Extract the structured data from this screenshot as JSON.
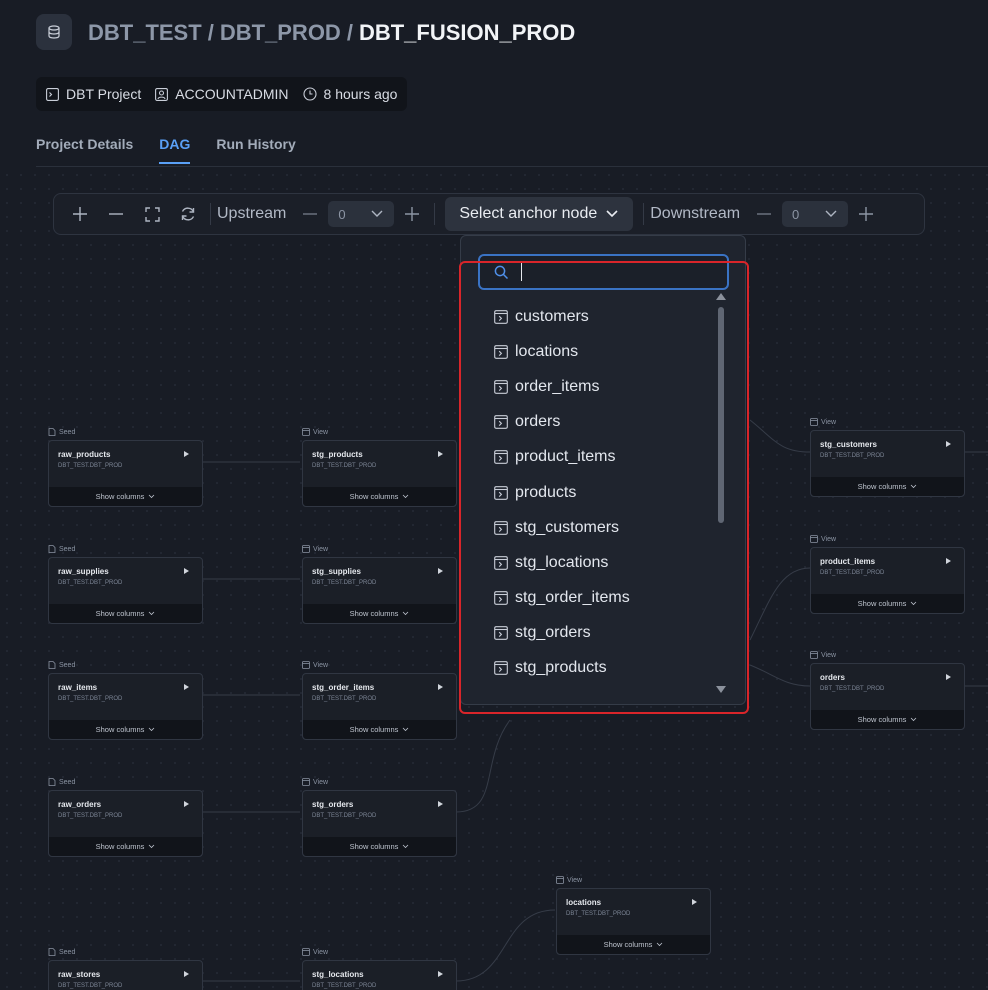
{
  "header": {
    "breadcrumb": [
      "DBT_TEST",
      "DBT_PROD",
      "DBT_FUSION_PROD"
    ],
    "meta": {
      "project": "DBT Project",
      "owner": "ACCOUNTADMIN",
      "modified": "8 hours ago"
    }
  },
  "tabs": [
    {
      "label": "Project Details",
      "active": false
    },
    {
      "label": "DAG",
      "active": true
    },
    {
      "label": "Run History",
      "active": false
    }
  ],
  "toolbar": {
    "upstream_label": "Upstream",
    "upstream_value": "0",
    "anchor_label": "Select anchor node",
    "downstream_label": "Downstream",
    "downstream_value": "0"
  },
  "dropdown": {
    "search_value": "",
    "options": [
      "customers",
      "locations",
      "order_items",
      "orders",
      "product_items",
      "products",
      "stg_customers",
      "stg_locations",
      "stg_order_items",
      "stg_orders",
      "stg_products"
    ]
  },
  "dag": {
    "show_columns_label": "Show columns",
    "nodes": [
      {
        "type": "Seed",
        "name": "raw_products",
        "schema": "DBT_TEST.DBT_PROD"
      },
      {
        "type": "View",
        "name": "stg_products",
        "schema": "DBT_TEST.DBT_PROD"
      },
      {
        "type": "View",
        "name": "stg_customers",
        "schema": "DBT_TEST.DBT_PROD"
      },
      {
        "type": "Seed",
        "name": "raw_supplies",
        "schema": "DBT_TEST.DBT_PROD"
      },
      {
        "type": "View",
        "name": "stg_supplies",
        "schema": "DBT_TEST.DBT_PROD"
      },
      {
        "type": "View",
        "name": "product_items",
        "schema": "DBT_TEST.DBT_PROD"
      },
      {
        "type": "Seed",
        "name": "raw_items",
        "schema": "DBT_TEST.DBT_PROD"
      },
      {
        "type": "View",
        "name": "stg_order_items",
        "schema": "DBT_TEST.DBT_PROD"
      },
      {
        "type": "View",
        "name": "orders",
        "schema": "DBT_TEST.DBT_PROD"
      },
      {
        "type": "Seed",
        "name": "raw_orders",
        "schema": "DBT_TEST.DBT_PROD"
      },
      {
        "type": "View",
        "name": "stg_orders",
        "schema": "DBT_TEST.DBT_PROD"
      },
      {
        "type": "View",
        "name": "locations",
        "schema": "DBT_TEST.DBT_PROD"
      },
      {
        "type": "Seed",
        "name": "raw_stores",
        "schema": "DBT_TEST.DBT_PROD"
      },
      {
        "type": "View",
        "name": "stg_locations",
        "schema": "DBT_TEST.DBT_PROD"
      }
    ]
  }
}
